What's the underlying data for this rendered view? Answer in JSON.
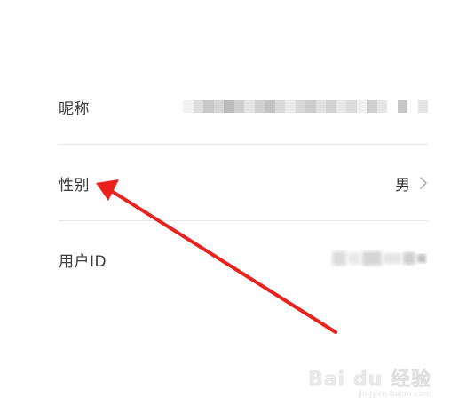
{
  "profile": {
    "nickname_label": "昵称",
    "gender_label": "性别",
    "gender_value": "男",
    "userid_label": "用户ID"
  },
  "icons": {
    "chevron": "chevron-right-icon",
    "annotation": "red-arrow"
  },
  "colors": {
    "annotation_arrow": "#e8231f",
    "label_text": "#3a3a3a",
    "divider": "#e6e6e6"
  },
  "watermark": {
    "logo": "Bai du 经验",
    "url": "jingyan.baidu.com"
  }
}
